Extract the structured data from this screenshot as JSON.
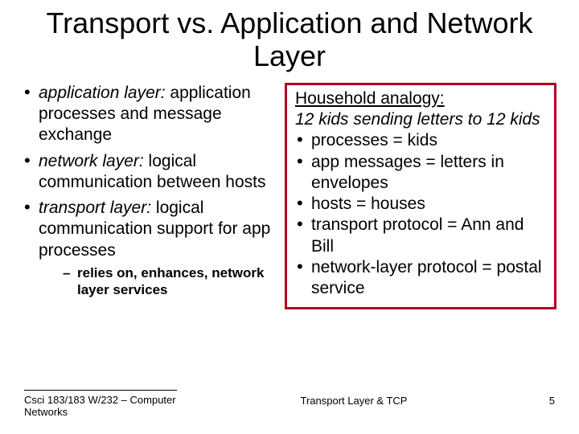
{
  "title": "Transport vs. Application and Network Layer",
  "left": {
    "items": [
      {
        "term": "application layer:",
        "desc": " application processes and message exchange"
      },
      {
        "term": "network layer:",
        "desc": " logical communication between hosts"
      },
      {
        "term": "transport layer:",
        "desc": " logical communication support for app processes"
      }
    ],
    "sub": "relies on, enhances, network layer services"
  },
  "right": {
    "heading": "Household analogy:",
    "subheading": "12 kids sending letters to 12 kids",
    "bullets": [
      "processes = kids",
      "app messages = letters in envelopes",
      "hosts = houses",
      "transport protocol = Ann and Bill",
      "network-layer protocol = postal service"
    ]
  },
  "footer": {
    "left": "Csci 183/183 W/232 – Computer Networks",
    "center": "Transport Layer &  TCP",
    "page": "5"
  }
}
